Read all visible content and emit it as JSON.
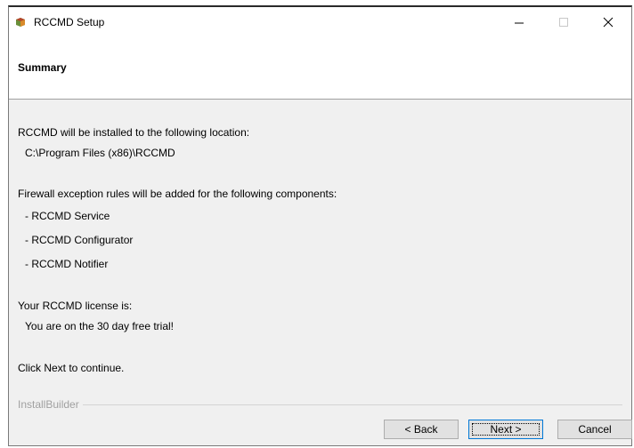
{
  "window": {
    "title": "RCCMD Setup",
    "icon": "rccmd-app-icon"
  },
  "header": {
    "title": "Summary"
  },
  "content": {
    "install_intro": "RCCMD will be installed to the following location:",
    "install_path": "C:\\Program Files (x86)\\RCCMD",
    "firewall_intro": "Firewall exception rules will be added for the following components:",
    "components": [
      "- RCCMD Service",
      "- RCCMD Configurator",
      "- RCCMD Notifier"
    ],
    "license_intro": "Your RCCMD license is:",
    "license_status": "You are on the 30 day free trial!",
    "continue_hint": "Click Next to continue."
  },
  "footer": {
    "brand": "InstallBuilder",
    "back_label": "< Back",
    "next_label": "Next >",
    "cancel_label": "Cancel"
  },
  "colors": {
    "window_bg": "#f0f0f0",
    "header_bg": "#ffffff",
    "focus_border": "#0078d7",
    "brand_text": "#a0a0a0"
  }
}
